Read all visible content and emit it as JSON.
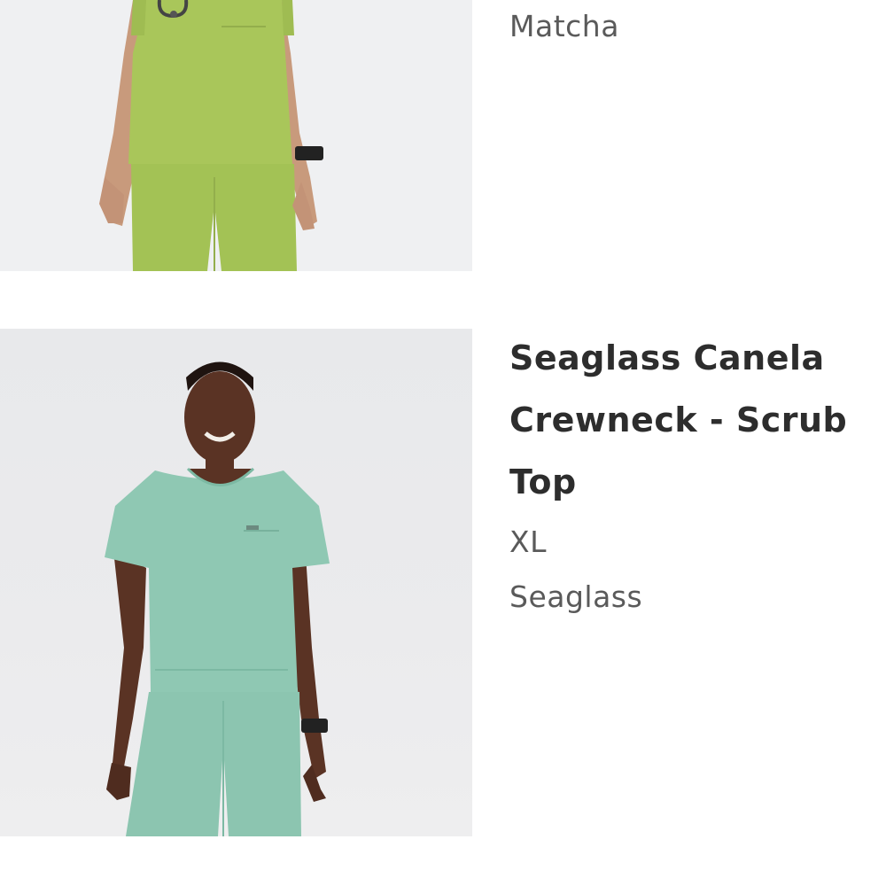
{
  "order_items": [
    {
      "name": "",
      "size": "",
      "color": "Matcha",
      "swatch_color": "#a9c65a"
    },
    {
      "name": "Seaglass Canela Crewneck - Scrub Top",
      "size": "XL",
      "color": "Seaglass",
      "swatch_color": "#8fc8b3"
    }
  ]
}
